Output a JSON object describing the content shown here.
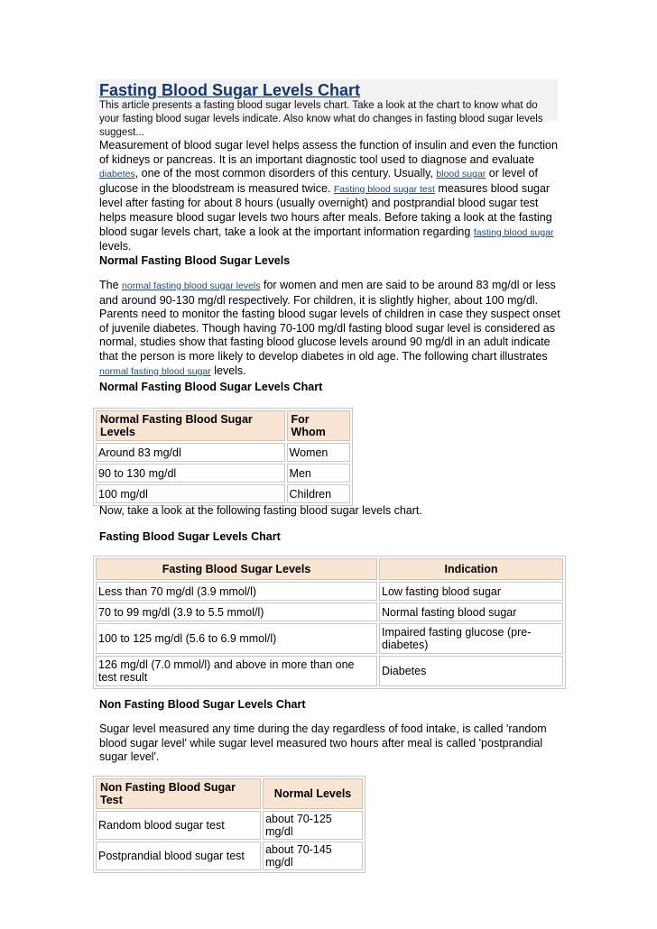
{
  "header": {
    "title": "Fasting Blood Sugar Levels Chart",
    "summary": "This article presents a fasting blood sugar levels chart. Take a look at the chart to know what do your fasting blood sugar levels indicate. Also know what do changes in fasting blood sugar levels suggest..."
  },
  "intro": {
    "t1": "Measurement of blood sugar level helps assess the function of insulin and even the function of kidneys or pancreas. It is an important diagnostic tool used to diagnose and evaluate ",
    "link1": "diabetes",
    "t2": ", one of the most common disorders of this century. Usually, ",
    "link2": "blood sugar",
    "t3": " or level of glucose in the bloodstream is measured twice. ",
    "link3": "Fasting blood sugar test",
    "t4": " measures blood sugar level after fasting for about 8 hours (usually overnight) and postprandial blood sugar test helps measure blood sugar levels two hours after meals. Before taking a look at the fasting blood sugar levels chart, take a look at the important information regarding ",
    "link4": "fasting blood sugar ",
    "t5": "levels."
  },
  "normal_section": {
    "heading": "Normal Fasting Blood Sugar Levels",
    "t1": "The ",
    "link1": "normal fasting blood sugar levels",
    "t2": " for women and men are said to be around 83 mg/dl or less and around 90-130 mg/dl respectively. For children, it is slightly higher, about 100 mg/dl. Parents need to monitor the fasting blood sugar levels of children in case they suspect onset of juvenile diabetes. Though having 70-100 mg/dl fasting blood sugar level is considered as normal, studies show that fasting blood glucose levels around 90 mg/dl in an adult indicate that the person is more likely to develop diabetes in old age. The following chart illustrates ",
    "link2": "normal fasting blood sugar",
    "t3": " levels."
  },
  "normal_chart": {
    "heading": "Normal Fasting Blood Sugar Levels Chart",
    "columns": [
      "Normal Fasting Blood Sugar Levels",
      "For Whom"
    ],
    "rows": [
      [
        "Around 83 mg/dl",
        "Women"
      ],
      [
        "90 to 130 mg/dl",
        "Men"
      ],
      [
        "100 mg/dl",
        "Children"
      ]
    ]
  },
  "transition": "Now, take a look at the following fasting blood sugar levels chart.",
  "fasting_chart": {
    "heading": "Fasting Blood Sugar Levels Chart",
    "columns": [
      "Fasting Blood Sugar Levels",
      "Indication"
    ],
    "rows": [
      [
        "Less than 70 mg/dl (3.9 mmol/l)",
        "Low fasting blood sugar"
      ],
      [
        "70 to 99 mg/dl (3.9 to 5.5 mmol/l)",
        "Normal fasting blood sugar"
      ],
      [
        "100 to 125 mg/dl (5.6 to 6.9 mmol/l)",
        "Impaired fasting glucose (pre-diabetes)"
      ],
      [
        "126 mg/dl (7.0 mmol/l) and above in more than one test result",
        "Diabetes"
      ]
    ]
  },
  "non_fasting": {
    "heading": "Non Fasting Blood Sugar Levels Chart",
    "text": "Sugar level measured any time during the day regardless of food intake, is called 'random blood sugar level' while sugar level measured two hours after meal is called 'postprandial sugar level'.",
    "columns": [
      "Non Fasting Blood Sugar Test",
      "Normal Levels"
    ],
    "rows": [
      [
        "Random blood sugar test",
        "about 70-125 mg/dl"
      ],
      [
        "Postprandial blood sugar test",
        "about 70-145 mg/dl"
      ]
    ]
  }
}
